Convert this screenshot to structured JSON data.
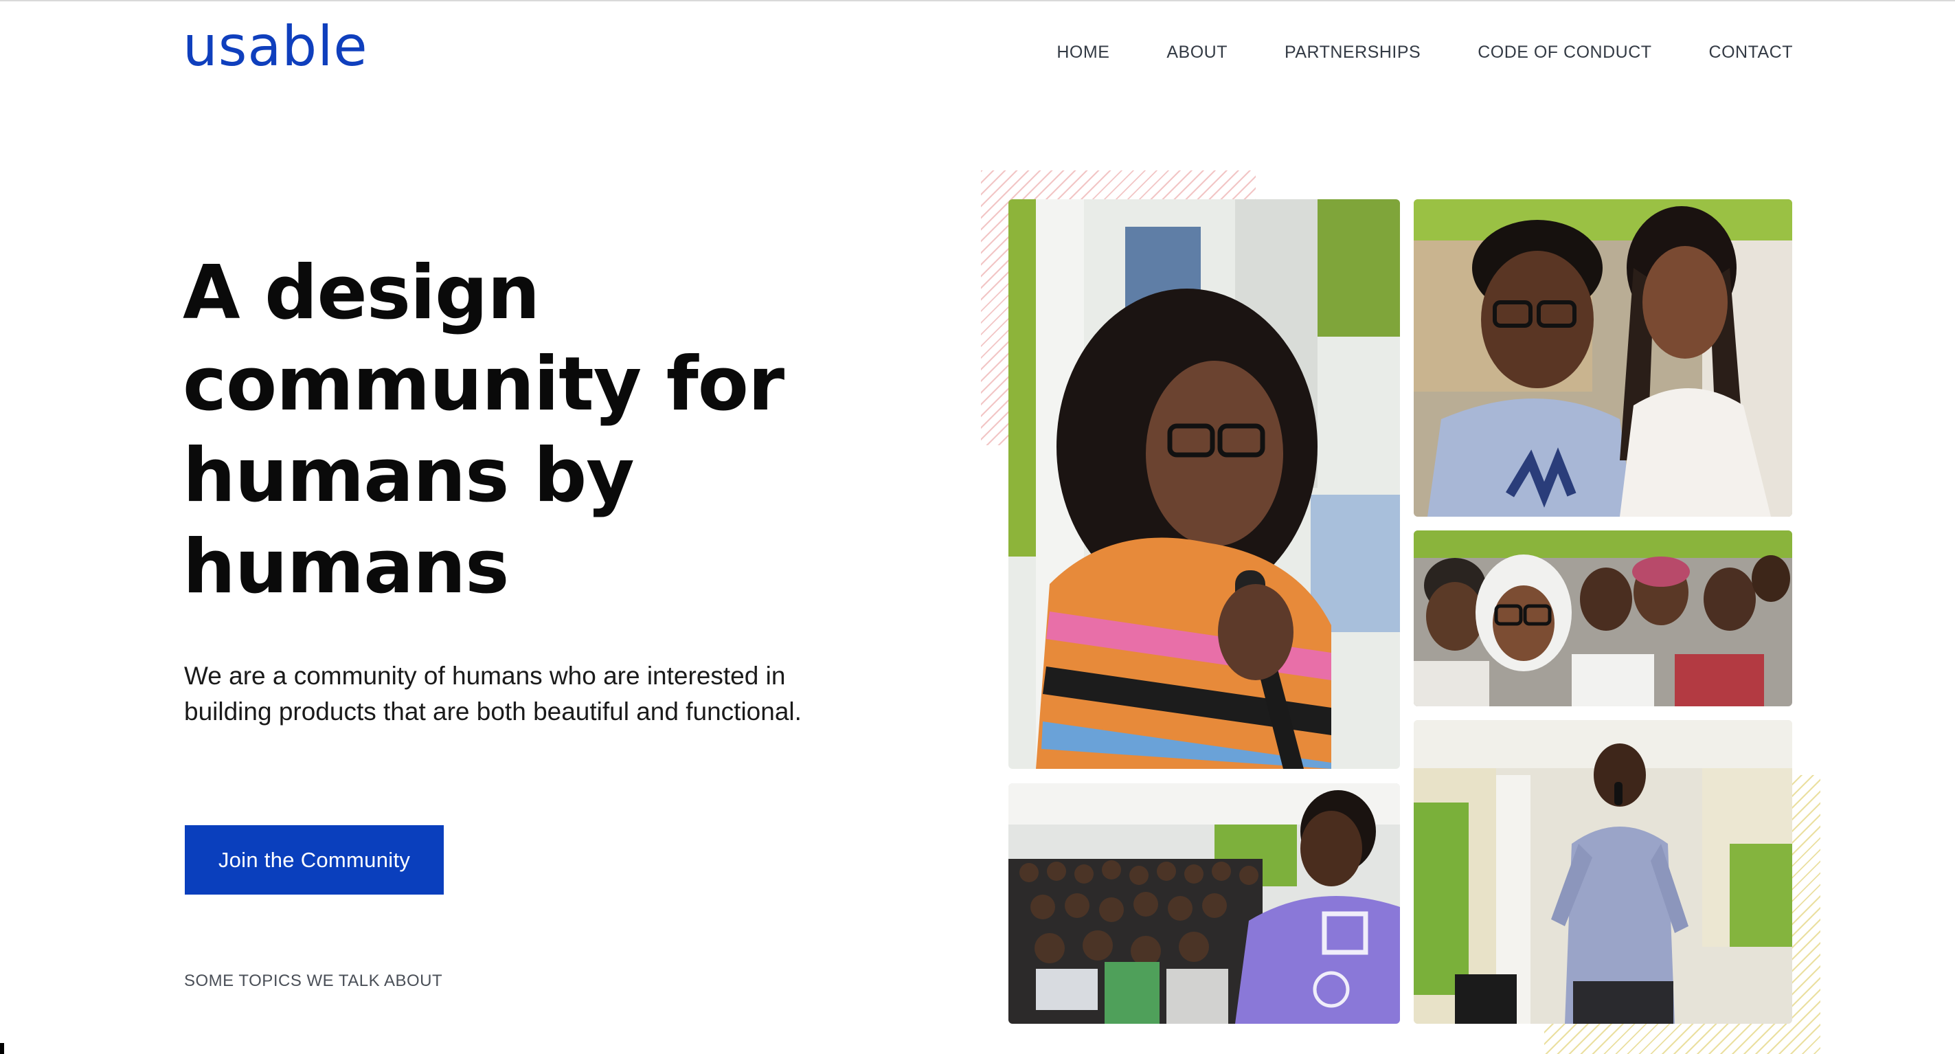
{
  "header": {
    "logo_text": "usable",
    "nav": [
      {
        "label": "HOME"
      },
      {
        "label": "ABOUT"
      },
      {
        "label": "PARTNERSHIPS"
      },
      {
        "label": "CODE OF CONDUCT"
      },
      {
        "label": "CONTACT"
      }
    ]
  },
  "hero": {
    "title_line1": "A design",
    "title_line2": "community for",
    "title_line3": "humans by",
    "title_line4": "humans",
    "subtitle": "We are a community of humans who are interested in building products that are both beautiful and functional.",
    "cta_label": "Join the Community",
    "topics_label": "SOME TOPICS WE TALK ABOUT"
  },
  "photos": [
    {
      "name": "speaker-woman-with-microphone"
    },
    {
      "name": "two-attendees-smiling"
    },
    {
      "name": "audience-group-smiling"
    },
    {
      "name": "crowd-in-auditorium"
    },
    {
      "name": "man-speaking-on-stage"
    }
  ],
  "colors": {
    "brand_blue": "#0a3fbd",
    "logo_blue": "#0f3fbd",
    "text_dark": "#0a0a0a",
    "nav_text": "#333a44",
    "hatch_red": "#e89696",
    "hatch_yellow": "#e2d278"
  }
}
